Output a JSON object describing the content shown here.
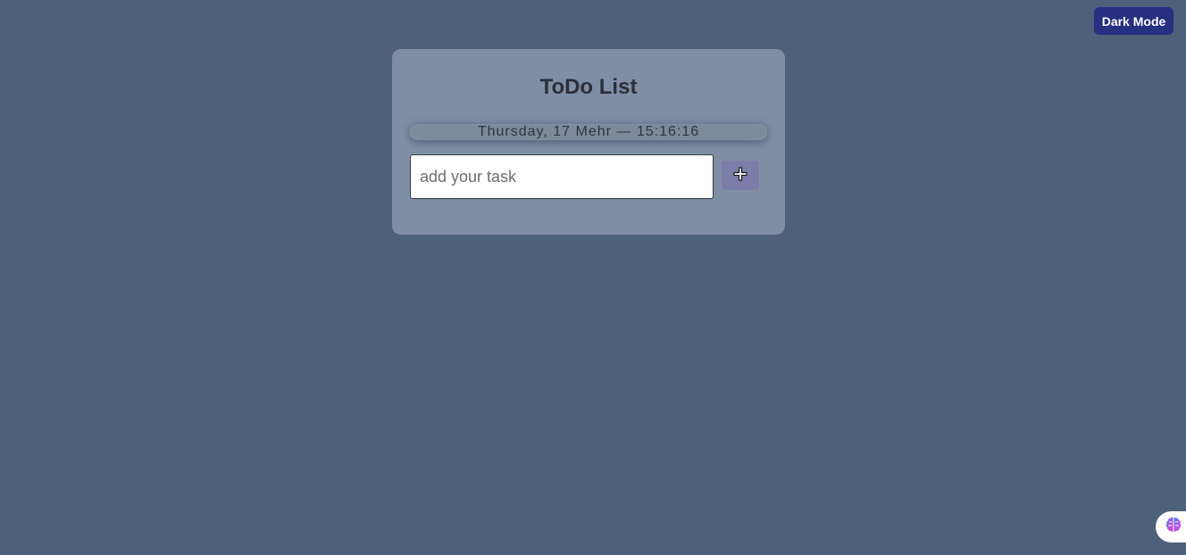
{
  "header": {
    "dark_mode_label": "Dark Mode"
  },
  "todo": {
    "title": "ToDo List",
    "datetime": "Thursday, 17 Mehr — 15:16:16",
    "input_placeholder": "add your task",
    "input_value": "",
    "add_button_icon": "plus-icon"
  },
  "widget": {
    "icon": "brain-icon"
  },
  "colors": {
    "background": "#4d617b",
    "card": "#7f8ea5",
    "dark_mode_button": "#262f80",
    "add_button": "#7a7ea8"
  }
}
